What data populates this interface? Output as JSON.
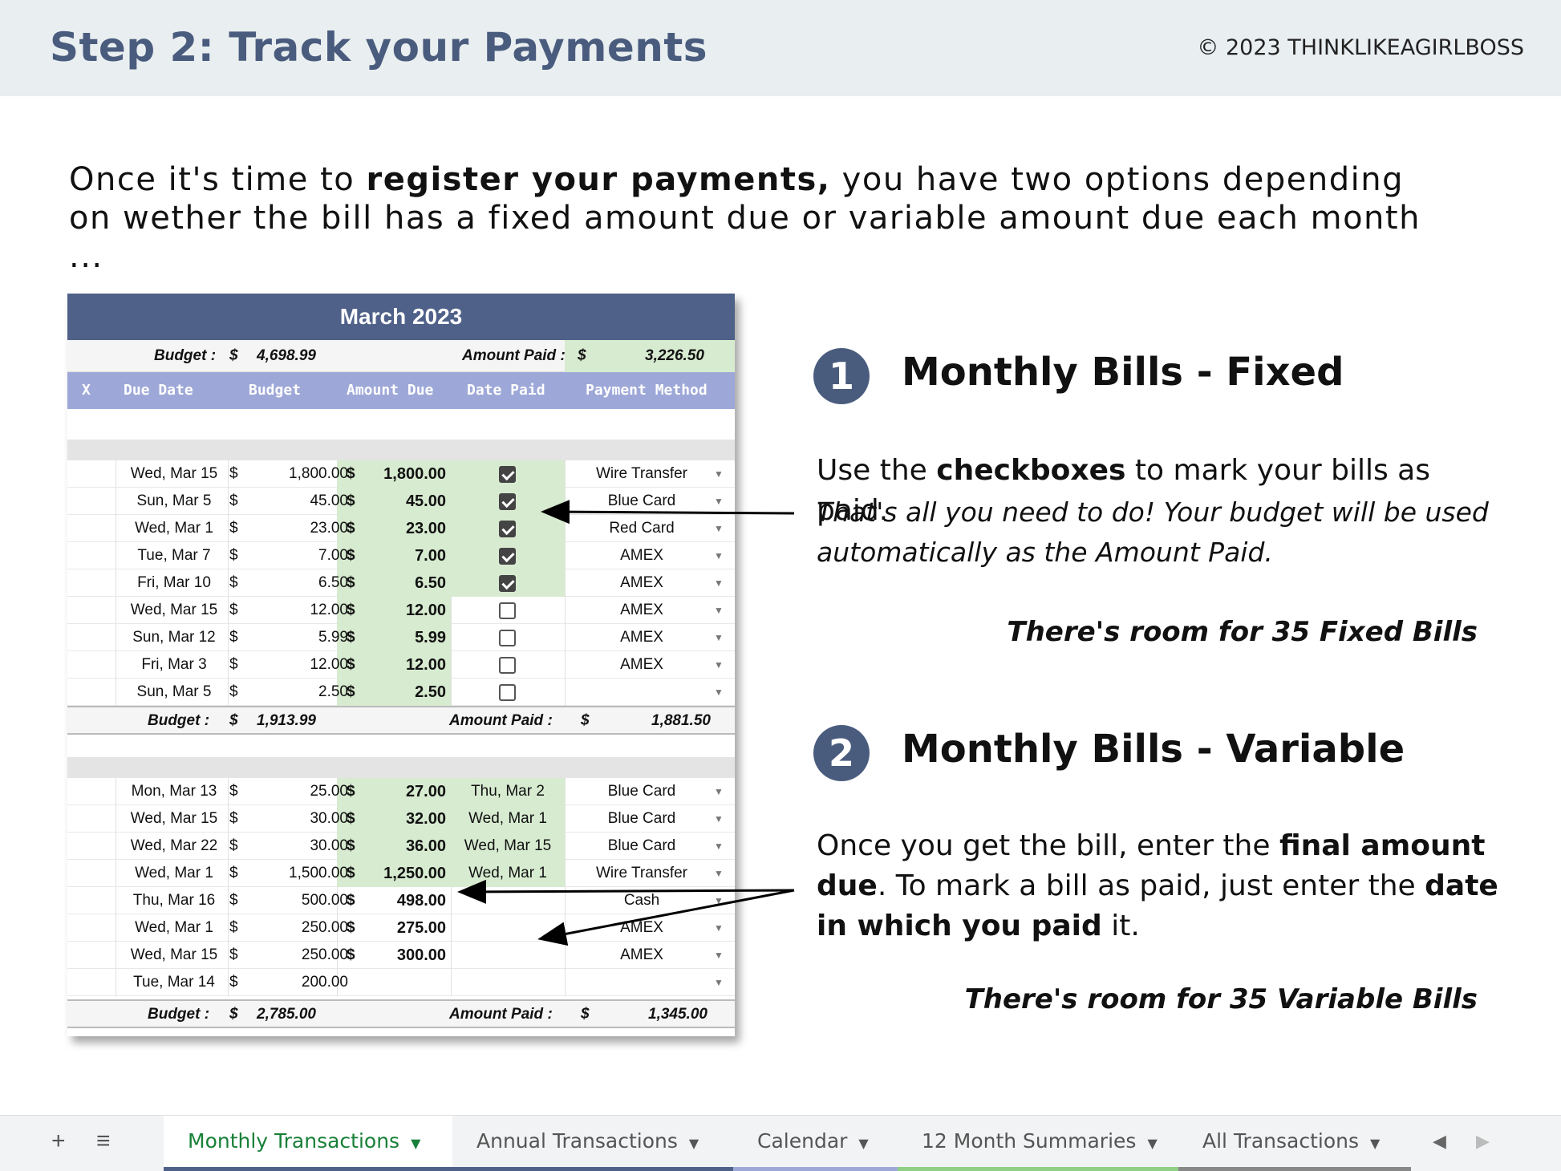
{
  "header": {
    "title": "Step 2: Track your Payments",
    "copyright": "© 2023 THINKLIKEAGIRLBOSS"
  },
  "intro": {
    "pre": "Once it's time to ",
    "bold": "register your payments,",
    "post": " you have two options depending on wether the bill has a fixed amount due or variable amount due each month ..."
  },
  "sheet": {
    "title": "March 2023",
    "budget_label": "Budget :",
    "budget_currency": "$",
    "budget_value": "4,698.99",
    "paid_label": "Amount Paid :",
    "paid_currency": "$",
    "paid_value": "3,226.50",
    "columns": [
      "X",
      "Due Date",
      "Budget",
      "Amount Due",
      "Date Paid",
      "Payment Method"
    ],
    "fixed_rows": [
      {
        "date": "Wed, Mar 15",
        "budget": "1,800.00",
        "amount": "1,800.00",
        "checked": true,
        "method": "Wire Transfer"
      },
      {
        "date": "Sun, Mar 5",
        "budget": "45.00",
        "amount": "45.00",
        "checked": true,
        "method": "Blue Card"
      },
      {
        "date": "Wed, Mar 1",
        "budget": "23.00",
        "amount": "23.00",
        "checked": true,
        "method": "Red Card"
      },
      {
        "date": "Tue, Mar 7",
        "budget": "7.00",
        "amount": "7.00",
        "checked": true,
        "method": "AMEX"
      },
      {
        "date": "Fri, Mar 10",
        "budget": "6.50",
        "amount": "6.50",
        "checked": true,
        "method": "AMEX"
      },
      {
        "date": "Wed, Mar 15",
        "budget": "12.00",
        "amount": "12.00",
        "checked": false,
        "method": "AMEX"
      },
      {
        "date": "Sun, Mar 12",
        "budget": "5.99",
        "amount": "5.99",
        "checked": false,
        "method": "AMEX"
      },
      {
        "date": "Fri, Mar 3",
        "budget": "12.00",
        "amount": "12.00",
        "checked": false,
        "method": "AMEX"
      },
      {
        "date": "Sun, Mar 5",
        "budget": "2.50",
        "amount": "2.50",
        "checked": false,
        "method": ""
      }
    ],
    "fixed_total": {
      "budget_label": "Budget :",
      "budget_value": "1,913.99",
      "paid_label": "Amount Paid :",
      "paid_value": "1,881.50"
    },
    "variable_rows": [
      {
        "date": "Mon, Mar 13",
        "budget": "25.00",
        "amount": "27.00",
        "paid": "Thu, Mar 2",
        "method": "Blue Card"
      },
      {
        "date": "Wed, Mar 15",
        "budget": "30.00",
        "amount": "32.00",
        "paid": "Wed, Mar 1",
        "method": "Blue Card"
      },
      {
        "date": "Wed, Mar 22",
        "budget": "30.00",
        "amount": "36.00",
        "paid": "Wed, Mar 15",
        "method": "Blue Card"
      },
      {
        "date": "Wed, Mar 1",
        "budget": "1,500.00",
        "amount": "1,250.00",
        "paid": "Wed, Mar 1",
        "method": "Wire Transfer"
      },
      {
        "date": "Thu, Mar 16",
        "budget": "500.00",
        "amount": "498.00",
        "paid": "",
        "method": "Cash"
      },
      {
        "date": "Wed, Mar 1",
        "budget": "250.00",
        "amount": "275.00",
        "paid": "",
        "method": "AMEX"
      },
      {
        "date": "Wed, Mar 15",
        "budget": "250.00",
        "amount": "300.00",
        "paid": "",
        "method": "AMEX"
      },
      {
        "date": "Tue, Mar 14",
        "budget": "200.00",
        "amount": "",
        "paid": "",
        "method": ""
      }
    ],
    "variable_total": {
      "budget_label": "Budget :",
      "budget_value": "2,785.00",
      "paid_label": "Amount Paid :",
      "paid_value": "1,345.00"
    }
  },
  "section1": {
    "number": "1",
    "title": "Monthly Bills - Fixed",
    "p1_pre": "Use the ",
    "p1_bold": "checkboxes",
    "p1_post": " to mark your bills as paid.",
    "p2": "That's all you need to do! Your budget will be used automatically as the Amount Paid.",
    "room": "There's room for 35 Fixed Bills"
  },
  "section2": {
    "number": "2",
    "title": "Monthly Bills - Variable",
    "t1": "Once you get the bill, enter the ",
    "b1": "final amount due",
    "t2": ". To mark a bill as paid, just enter the ",
    "b2": "date in which you paid",
    "t3": " it.",
    "room": "There's room for 35 Variable Bills"
  },
  "tabs": {
    "add_icon": "plus-icon",
    "menu_icon": "list-icon",
    "items": [
      {
        "label": "Monthly Transactions",
        "color": "#188038"
      },
      {
        "label": "Annual Transactions",
        "color": "#4f6189"
      },
      {
        "label": "Calendar",
        "color": "#9ea8d8"
      },
      {
        "label": "12 Month Summaries",
        "color": "#8fcf86"
      },
      {
        "label": "All Transactions",
        "color": "#888888"
      }
    ]
  },
  "colors": {
    "header_bg": "#e9eef0",
    "title": "#4a5c7e",
    "sheet_title_bg": "#4f6189",
    "column_header_bg": "#9ea8d8",
    "paid_green": "#d7ebd0"
  }
}
